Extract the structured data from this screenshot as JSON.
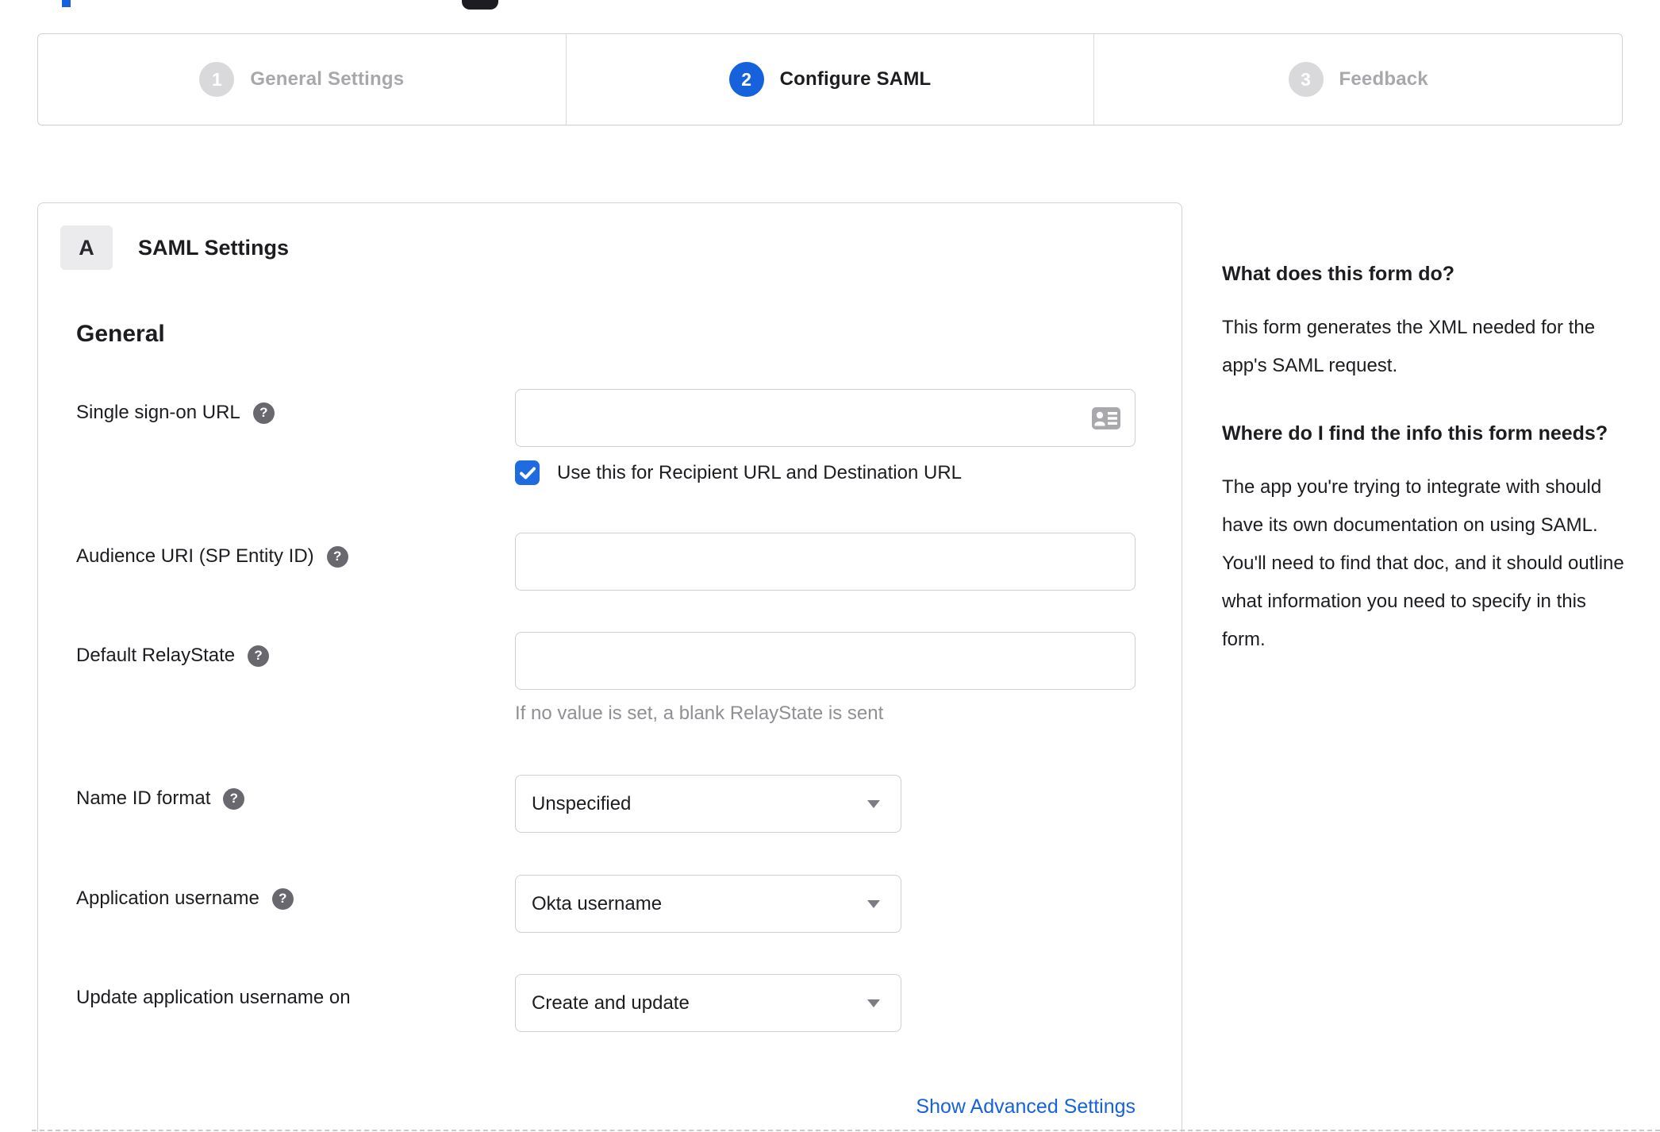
{
  "colors": {
    "accent_blue": "#1662dd",
    "checkbox_blue": "#1f6be0",
    "link_blue": "#1662dd",
    "border_gray": "#d2d2d5",
    "inactive_gray": "#a8a8ac",
    "text_dark": "#1d1d21",
    "hint_gray": "#8f8f94"
  },
  "stepper": {
    "steps": [
      {
        "number": "1",
        "label": "General Settings",
        "state": "inactive"
      },
      {
        "number": "2",
        "label": "Configure SAML",
        "state": "active"
      },
      {
        "number": "3",
        "label": "Feedback",
        "state": "inactive"
      }
    ]
  },
  "panel": {
    "badge": "A",
    "title": "SAML Settings",
    "heading": "General",
    "sso": {
      "label": "Single sign-on URL",
      "value": "",
      "checkbox_label": "Use this for Recipient URL and Destination URL",
      "checkbox_checked": true
    },
    "audience": {
      "label": "Audience URI (SP Entity ID)",
      "value": ""
    },
    "relay": {
      "label": "Default RelayState",
      "value": "",
      "hint": "If no value is set, a blank RelayState is sent"
    },
    "nameid": {
      "label": "Name ID format",
      "value": "Unspecified"
    },
    "appuser": {
      "label": "Application username",
      "value": "Okta username"
    },
    "updateuser": {
      "label": "Update application username on",
      "value": "Create and update"
    },
    "advanced_link": "Show Advanced Settings"
  },
  "sidebar": {
    "q1": "What does this form do?",
    "a1": "This form generates the XML needed for the app's SAML request.",
    "q2": "Where do I find the info this form needs?",
    "a2": "The app you're trying to integrate with should have its own documentation on using SAML. You'll need to find that doc, and it should outline what information you need to specify in this form."
  }
}
